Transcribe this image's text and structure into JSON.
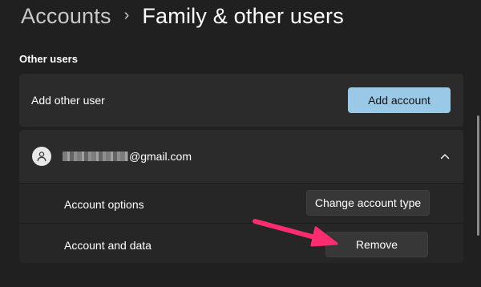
{
  "breadcrumb": {
    "parent": "Accounts",
    "separator": "›",
    "current": "Family & other users"
  },
  "section": {
    "title": "Other users"
  },
  "add_user": {
    "label": "Add other user",
    "button": "Add account"
  },
  "user": {
    "email_visible": "@gmail.com",
    "email_redacted": true,
    "avatar_icon": "person-icon",
    "expand_icon": "chevron-up-icon",
    "rows": [
      {
        "label": "Account options",
        "button": "Change account type"
      },
      {
        "label": "Account and data",
        "button": "Remove"
      }
    ]
  },
  "colors": {
    "background": "#202020",
    "card": "#2b2b2b",
    "accent_button": "#99c9e6",
    "annotation_arrow": "#ff2d6f"
  }
}
